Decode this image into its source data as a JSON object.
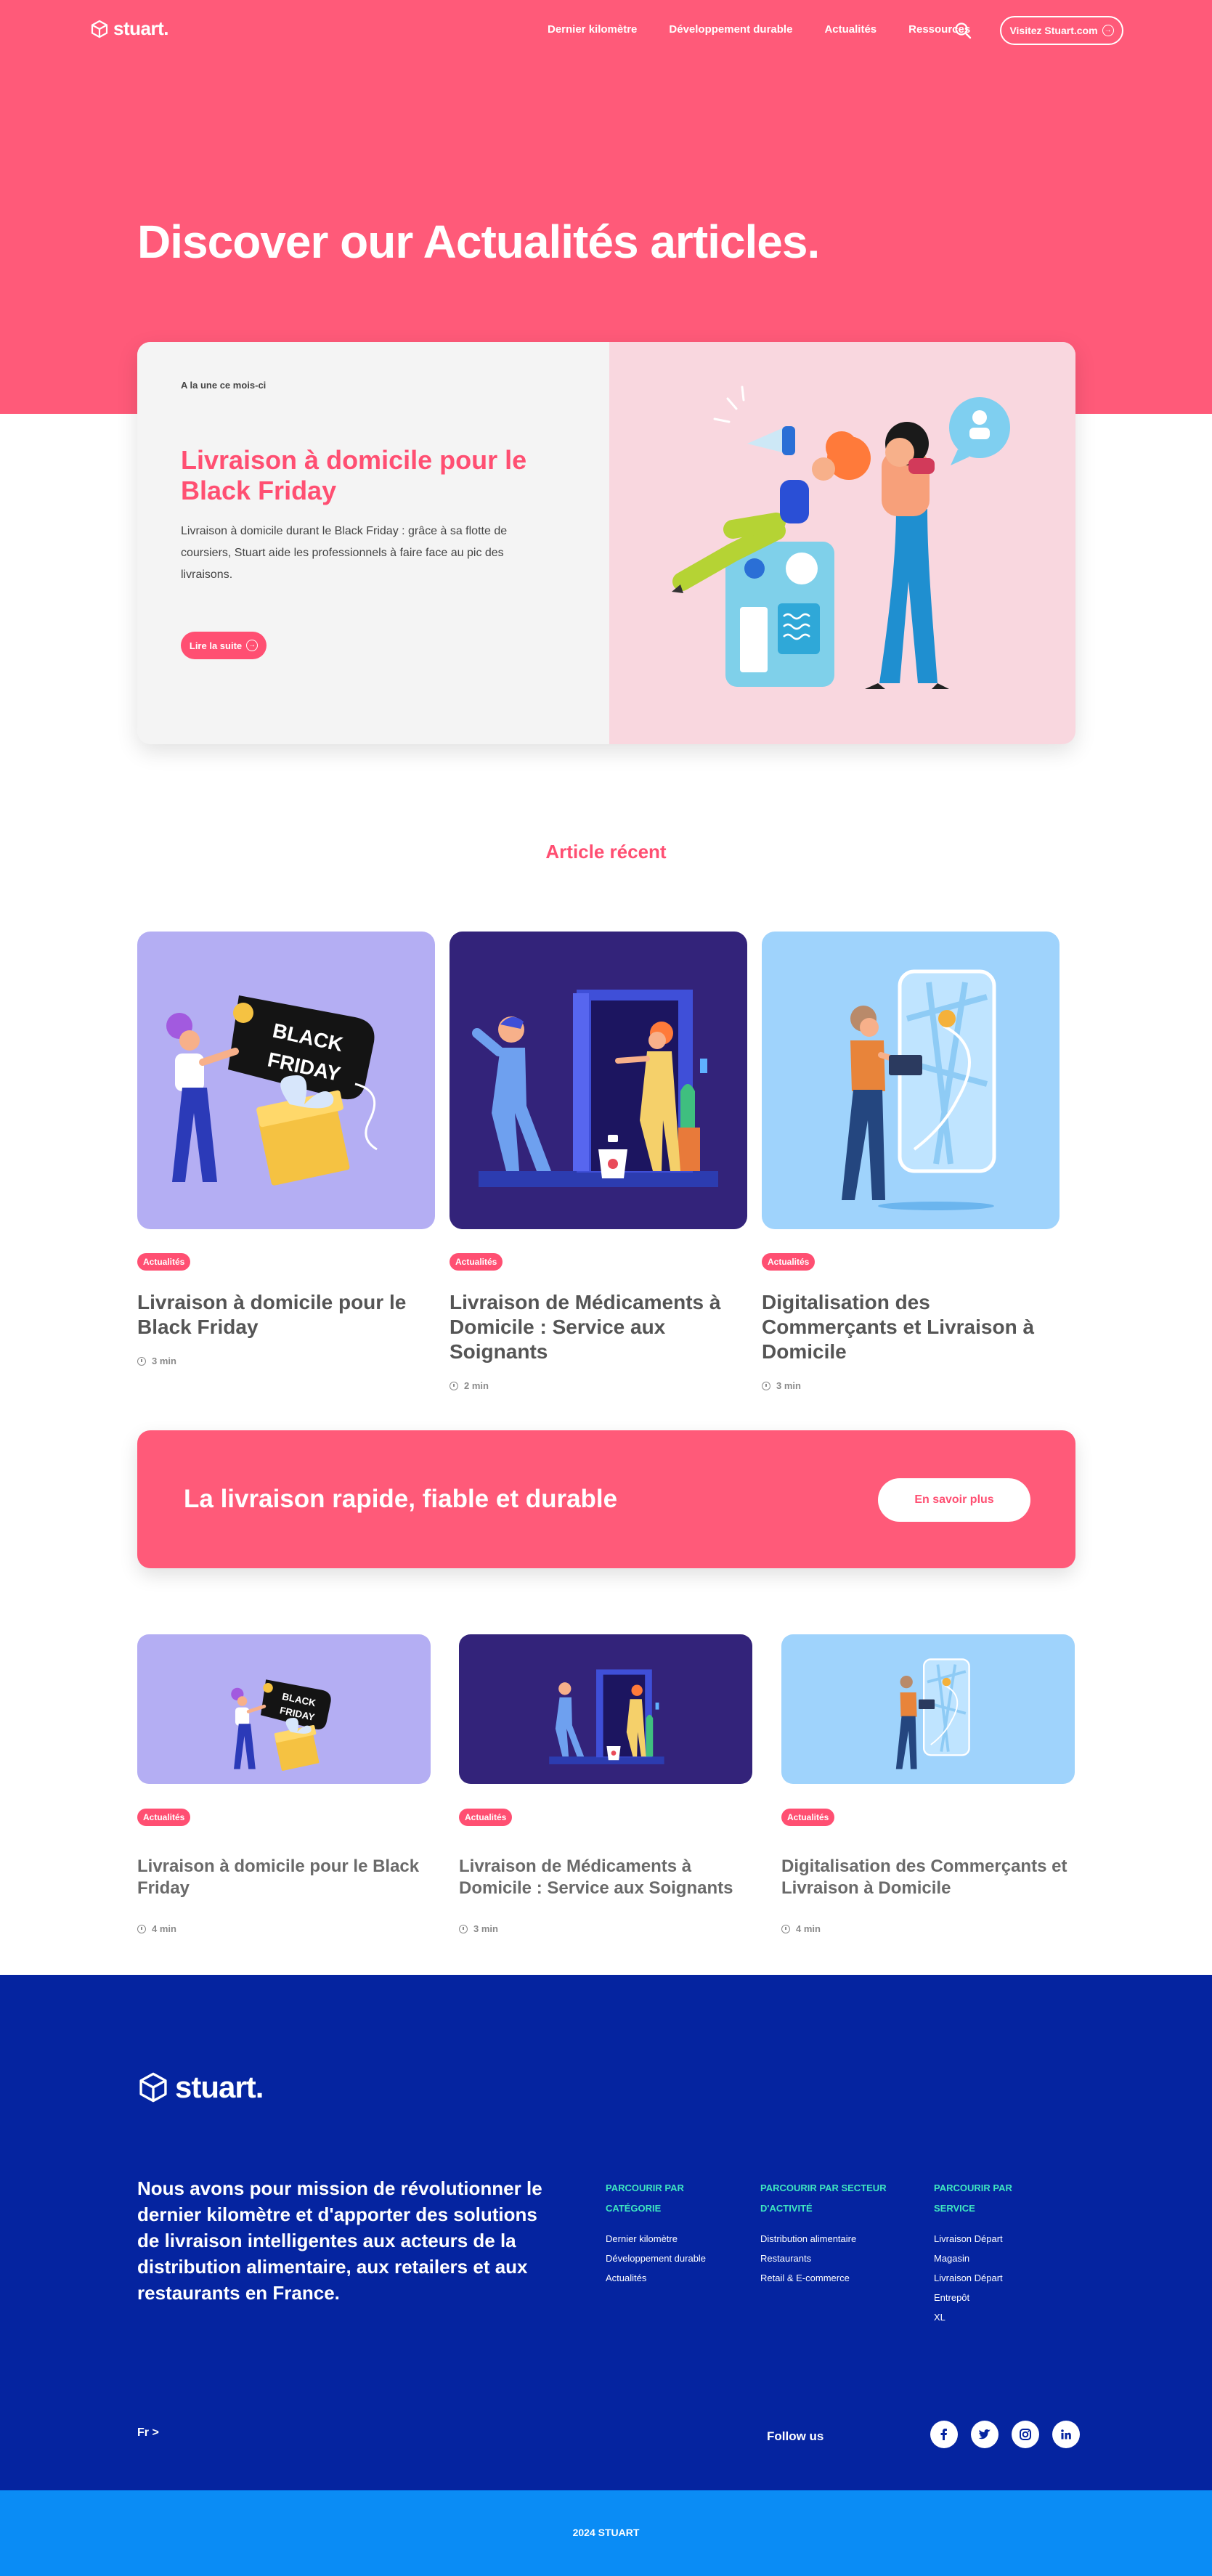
{
  "nav": {
    "logo": "stuart.",
    "links": [
      "Dernier kilomètre",
      "Développement durable",
      "Actualités",
      "Ressources"
    ],
    "cta": "Visitez Stuart.com"
  },
  "hero": {
    "title": "Discover our Actualités articles."
  },
  "featured": {
    "kicker": "A la une ce mois-ci",
    "title": "Livraison à domicile pour le Black Friday",
    "description": "Livraison à domicile durant le Black Friday : grâce à sa flotte de coursiers, Stuart aide les professionnels à faire face au pic des livraisons.",
    "button": "Lire la suite"
  },
  "recent": {
    "heading": "Article récent",
    "cards": [
      {
        "tag": "Actualités",
        "title": "Livraison à domicile pour le Black Friday",
        "time": "3 min",
        "image_text": [
          "BLACK",
          "FRIDAY"
        ]
      },
      {
        "tag": "Actualités",
        "title": "Livraison de Médicaments à Domicile : Service aux Soignants",
        "time": "2 min"
      },
      {
        "tag": "Actualités",
        "title": "Digitalisation des Commerçants et Livraison à Domicile",
        "time": "3 min"
      }
    ]
  },
  "banner": {
    "text": "La livraison rapide, fiable et durable",
    "button": "En savoir plus"
  },
  "more": {
    "cards": [
      {
        "tag": "Actualités",
        "title": "Livraison à domicile pour le Black Friday",
        "time": "4 min",
        "image_text": [
          "BLACK",
          "FRIDAY"
        ]
      },
      {
        "tag": "Actualités",
        "title": "Livraison de Médicaments à Domicile : Service aux Soignants",
        "time": "3 min"
      },
      {
        "tag": "Actualités",
        "title": "Digitalisation des Commerçants et Livraison à Domicile",
        "time": "4 min"
      }
    ]
  },
  "footer": {
    "logo": "stuart.",
    "mission": "Nous avons pour mission de révolutionner le dernier kilomètre et d'apporter des solutions de livraison intelligentes aux acteurs de la distribution alimentaire, aux retailers et aux restaurants en France.",
    "columns": [
      {
        "title": "Parcourir par catégorie",
        "links": [
          "Dernier kilomètre",
          "Développement durable",
          "Actualités"
        ]
      },
      {
        "title": "Parcourir par secteur d'activité",
        "links": [
          "Distribution alimentaire",
          "Restaurants",
          "Retail & E-commerce"
        ]
      },
      {
        "title": "Parcourir par service",
        "links": [
          "Livraison Départ",
          "Magasin",
          "Livraison Départ",
          "Entrepôt",
          "XL"
        ]
      }
    ],
    "language": "Fr >",
    "follow": "Follow us",
    "socials": [
      "facebook-icon",
      "twitter-icon",
      "instagram-icon",
      "linkedin-icon"
    ],
    "copyright": "2024 STUART"
  },
  "colors": {
    "brand_pink": "#ff5a79",
    "accent_pink": "#ff4f72",
    "footer_blue": "#0524a0",
    "bottom_blue": "#0a8cf5",
    "footer_heading": "#3ee6c1"
  }
}
